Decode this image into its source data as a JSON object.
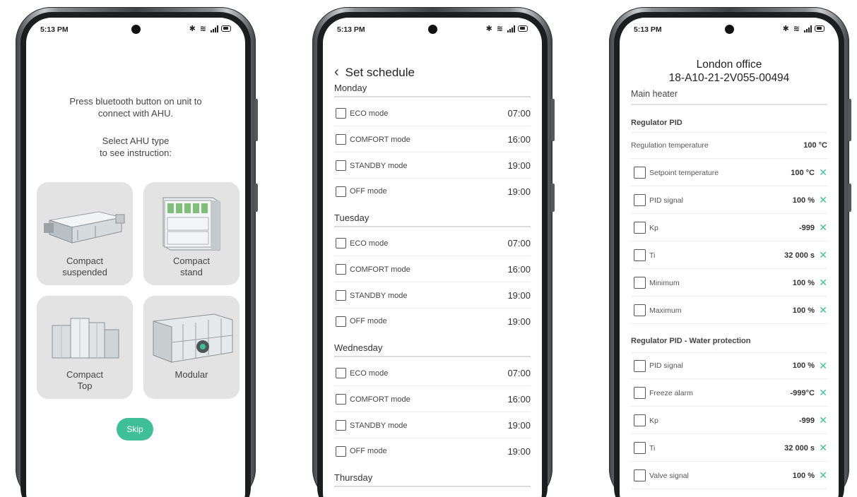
{
  "status": {
    "time": "5:13 PM"
  },
  "phone1": {
    "instruction_line1": "Press bluetooth button on unit to",
    "instruction_line2": "connect with AHU.",
    "select_line1": "Select AHU type",
    "select_line2": "to see instruction:",
    "tiles": [
      {
        "line1": "Compact",
        "line2": "suspended"
      },
      {
        "line1": "Compact",
        "line2": "stand"
      },
      {
        "line1": "Compact",
        "line2": "Top"
      },
      {
        "line1": "Modular",
        "line2": ""
      }
    ],
    "skip_label": "Skip"
  },
  "phone2": {
    "title": "Set schedule",
    "days": [
      {
        "name": "Monday",
        "rows": [
          {
            "label": "ECO mode",
            "time": "07:00"
          },
          {
            "label": "COMFORT mode",
            "time": "16:00"
          },
          {
            "label": "STANDBY mode",
            "time": "19:00"
          },
          {
            "label": "OFF mode",
            "time": "19:00"
          }
        ]
      },
      {
        "name": "Tuesday",
        "rows": [
          {
            "label": "ECO mode",
            "time": "07:00"
          },
          {
            "label": "COMFORT mode",
            "time": "16:00"
          },
          {
            "label": "STANDBY mode",
            "time": "19:00"
          },
          {
            "label": "OFF mode",
            "time": "19:00"
          }
        ]
      },
      {
        "name": "Wednesday",
        "rows": [
          {
            "label": "ECO mode",
            "time": "07:00"
          },
          {
            "label": "COMFORT mode",
            "time": "16:00"
          },
          {
            "label": "STANDBY mode",
            "time": "19:00"
          },
          {
            "label": "OFF mode",
            "time": "19:00"
          }
        ]
      },
      {
        "name": "Thursday",
        "rows": []
      }
    ]
  },
  "phone3": {
    "title_line1": "London office",
    "title_line2": "18-A10-21-2V055-00494",
    "section": "Main heater",
    "group1": "Regulator PID",
    "regulation_label": "Regulation temperature",
    "regulation_value": "100 °C",
    "group1_rows": [
      {
        "label": "Setpoint temperature",
        "value": "100 °C"
      },
      {
        "label": "PID signal",
        "value": "100 %"
      },
      {
        "label": "Kp",
        "value": "-999"
      },
      {
        "label": "Ti",
        "value": "32 000 s"
      },
      {
        "label": "Minimum",
        "value": "100 %"
      },
      {
        "label": "Maximum",
        "value": "100 %"
      }
    ],
    "group2": "Regulator PID - Water protection",
    "group2_rows": [
      {
        "label": "PID signal",
        "value": "100 %"
      },
      {
        "label": "Freeze alarm",
        "value": "-999°C"
      },
      {
        "label": "Kp",
        "value": "-999"
      },
      {
        "label": "Ti",
        "value": "32 000 s"
      },
      {
        "label": "Valve signal",
        "value": "100 %"
      }
    ]
  },
  "colors": {
    "accent": "#3fbf96",
    "tile_bg": "#e3e3e3",
    "frame": "#3f4345"
  }
}
